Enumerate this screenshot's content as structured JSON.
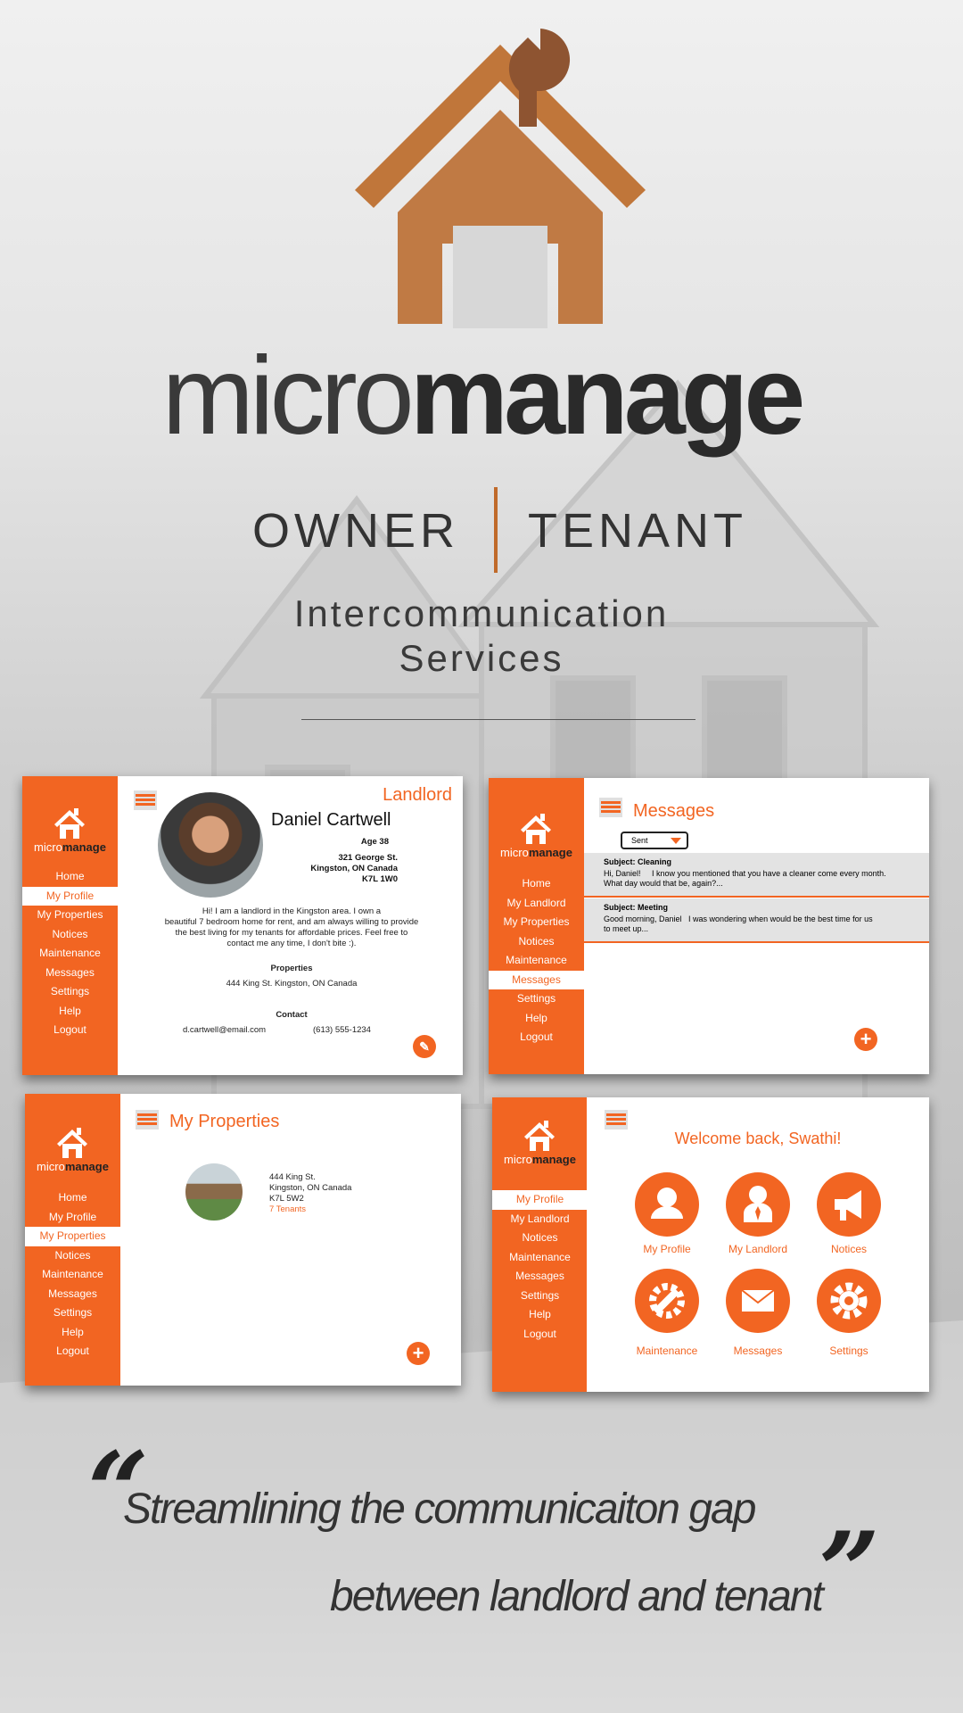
{
  "brand": {
    "part1": "micro",
    "part2": "manage"
  },
  "roles": {
    "left": "OWNER",
    "right": "TENANT"
  },
  "tagline": {
    "line1": "Intercommunication",
    "line2": "Services"
  },
  "colors": {
    "accent": "#f26522",
    "logo": "#c0763a",
    "logo_dark": "#8e5431"
  },
  "sidebar_brand": {
    "part1": "micro",
    "part2": "manage"
  },
  "profile_screen": {
    "nav": [
      "Home",
      "My Profile",
      "My Properties",
      "Notices",
      "Maintenance",
      "Messages",
      "Settings",
      "Help",
      "Logout"
    ],
    "active": "My Profile",
    "role": "Landlord",
    "name": "Daniel Cartwell",
    "age": "Age 38",
    "address": [
      "321 George St.",
      "Kingston, ON Canada",
      "K7L 1W0"
    ],
    "bio": [
      "Hi! I am a landlord in the Kingston area. I own a",
      "beautiful 7 bedroom home for rent, and am always willing to provide",
      "the best living for my tenants for affordable prices. Feel free to",
      "contact me any time, I don't bite :)."
    ],
    "properties_heading": "Properties",
    "property": "444 King St. Kingston, ON Canada",
    "contact_heading": "Contact",
    "email": "d.cartwell@email.com",
    "phone": "(613) 555-1234",
    "icons": [
      "menu-icon",
      "pencil-icon"
    ]
  },
  "messages_screen": {
    "nav": [
      "Home",
      "My Landlord",
      "My Properties",
      "Notices",
      "Maintenance",
      "Messages",
      "Settings",
      "Help",
      "Logout"
    ],
    "active": "Messages",
    "title": "Messages",
    "filter": "Sent",
    "items": [
      {
        "subject": "Subject: Cleaning",
        "body1": "Hi, Daniel!     I know you mentioned that you have a cleaner come every month.",
        "body2": "What day would that be, again?..."
      },
      {
        "subject": "Subject: Meeting",
        "body1": "Good morning, Daniel   I was wondering when would be the best time for us",
        "body2": "to meet up..."
      }
    ],
    "icons": [
      "menu-icon",
      "plus-icon"
    ]
  },
  "properties_screen": {
    "nav": [
      "Home",
      "My Profile",
      "My Properties",
      "Notices",
      "Maintenance",
      "Messages",
      "Settings",
      "Help",
      "Logout"
    ],
    "active": "My Properties",
    "title": "My Properties",
    "property": {
      "line1": "444 King St.",
      "line2": "Kingston, ON Canada",
      "line3": "K7L 5W2",
      "tenants": "7 Tenants"
    },
    "icons": [
      "menu-icon",
      "plus-icon"
    ]
  },
  "home_screen": {
    "nav": [
      "My Profile",
      "My Landlord",
      "Notices",
      "Maintenance",
      "Messages",
      "Settings",
      "Help",
      "Logout"
    ],
    "active": "My Profile",
    "welcome": "Welcome back, Swathi!",
    "tiles": [
      {
        "label": "My Profile",
        "icon": "user-icon"
      },
      {
        "label": "My Landlord",
        "icon": "landlord-icon"
      },
      {
        "label": "Notices",
        "icon": "megaphone-icon"
      },
      {
        "label": "Maintenance",
        "icon": "wrench-gear-icon"
      },
      {
        "label": "Messages",
        "icon": "envelope-icon"
      },
      {
        "label": "Settings",
        "icon": "gear-icon"
      }
    ]
  },
  "quote": {
    "line1": "Streamlining the communicaiton gap",
    "line2": "between landlord and tenant"
  }
}
